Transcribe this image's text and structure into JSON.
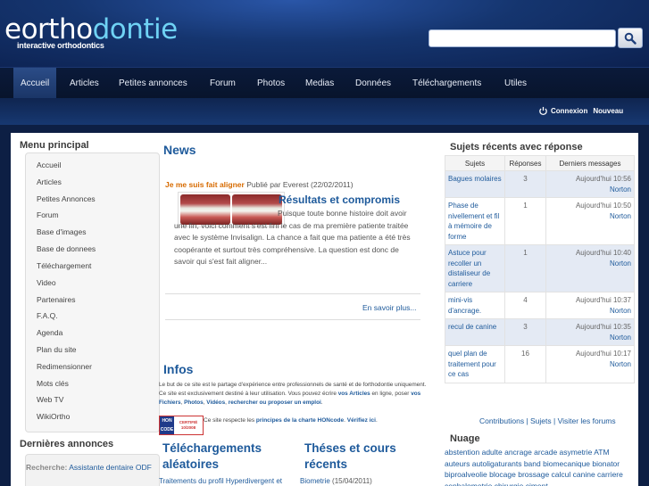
{
  "header": {
    "logo_part1": "eortho",
    "logo_part2": "dontie",
    "tagline": "interactive orthodontics",
    "search_placeholder": ""
  },
  "nav": {
    "items": [
      "Accueil",
      "Articles",
      "Petites annonces",
      "Forum",
      "Photos",
      "Medias",
      "Données",
      "Téléchargements",
      "Utiles"
    ],
    "active": "Accueil"
  },
  "subbar": {
    "login_label": "Connexion",
    "new_label": "Nouveau"
  },
  "sidebar": {
    "menu_title": "Menu principal",
    "items": [
      "Accueil",
      "Articles",
      "Petites Annonces",
      "Forum",
      "Base d'images",
      "Base de donnees",
      "Téléchargement",
      "Video",
      "Partenaires",
      "F.A.Q.",
      "Agenda",
      "Plan du site",
      "Redimensionner",
      "Mots clés",
      "Web TV",
      "WikiOrtho"
    ],
    "annonces_title": "Dernières annonces",
    "annonce_label": "Recherche:",
    "annonce_link": "Assistante dentaire ODF"
  },
  "news": {
    "title": "News",
    "item_title": "Je me suis fait aligner",
    "item_meta": "Publié par Everest (22/02/2011)",
    "headline": "Résultats et compromis",
    "body": "Puisque toute bonne histoire doit avoir une fin, voici comment s'est fini le cas de ma première patiente traitée avec le système Invisalign. La chance a fait que ma patiente a été très coopérante et surtout très compréhensive. La question est donc de savoir qui s'est fait aligner...",
    "more": "En savoir plus..."
  },
  "infos": {
    "title": "Infos",
    "text1": "Le but de ce site est le partage d'expérience entre professionnels de santé et de forthodontie uniquement. Ce site est exclusivement destiné à leur utilisation. Vous pouvez écrire ",
    "link1": "vos Articles",
    "text2": " en ligne, poser ",
    "link2": "vos Fichiers",
    "text3": ", ",
    "link3": "Photos",
    "text4": ", ",
    "link4": "Vidéos",
    "text5": ", ",
    "link5": "rechercher ou proposer un emploi",
    "text6": ".",
    "badge_left": "HON CODE",
    "badge_right": "CERTIFIÉ 10/2008",
    "hon_text": "Ce site respecte les ",
    "hon_link": "principes de la charte HONcode",
    "hon_verify": "Vérifiez ici"
  },
  "downloads": {
    "title": "Téléchargements aléatoires",
    "link": "Traitements du profil Hyperdivergent et"
  },
  "theses": {
    "title": "Théses et cours récents",
    "link": "Biometrie",
    "date": "(15/04/2011)"
  },
  "sujets": {
    "title": "Sujets récents avec réponse",
    "headers": [
      "Sujets",
      "Réponses",
      "Derniers messages"
    ],
    "rows": [
      {
        "subject": "Bagues molaires",
        "replies": "3",
        "when": "Aujourd'hui 10:56",
        "user": "Norton"
      },
      {
        "subject": "Phase de nivellement et fil à mémoire de forme",
        "replies": "1",
        "when": "Aujourd'hui 10:50",
        "user": "Norton"
      },
      {
        "subject": "Astuce pour recoller un distaliseur de carriere",
        "replies": "1",
        "when": "Aujourd'hui 10:40",
        "user": "Norton"
      },
      {
        "subject": "mini-vis d'ancrage.",
        "replies": "4",
        "when": "Aujourd'hui 10:37",
        "user": "Norton"
      },
      {
        "subject": "recul de canine",
        "replies": "3",
        "when": "Aujourd'hui 10:35",
        "user": "Norton"
      },
      {
        "subject": "quel plan de traitement pour ce cas",
        "replies": "16",
        "when": "Aujourd'hui 10:17",
        "user": "Norton"
      }
    ],
    "links": "Contributions | Sujets | Visiter les forums"
  },
  "nuage": {
    "title": "Nuage",
    "text": "abstention adulte ancrage arcade asymetrie ATM auteurs autoligaturants band biomecanique bionator biproalveolie blocage brossage calcul canine carriere cephalometrie chirurgie ciment"
  }
}
